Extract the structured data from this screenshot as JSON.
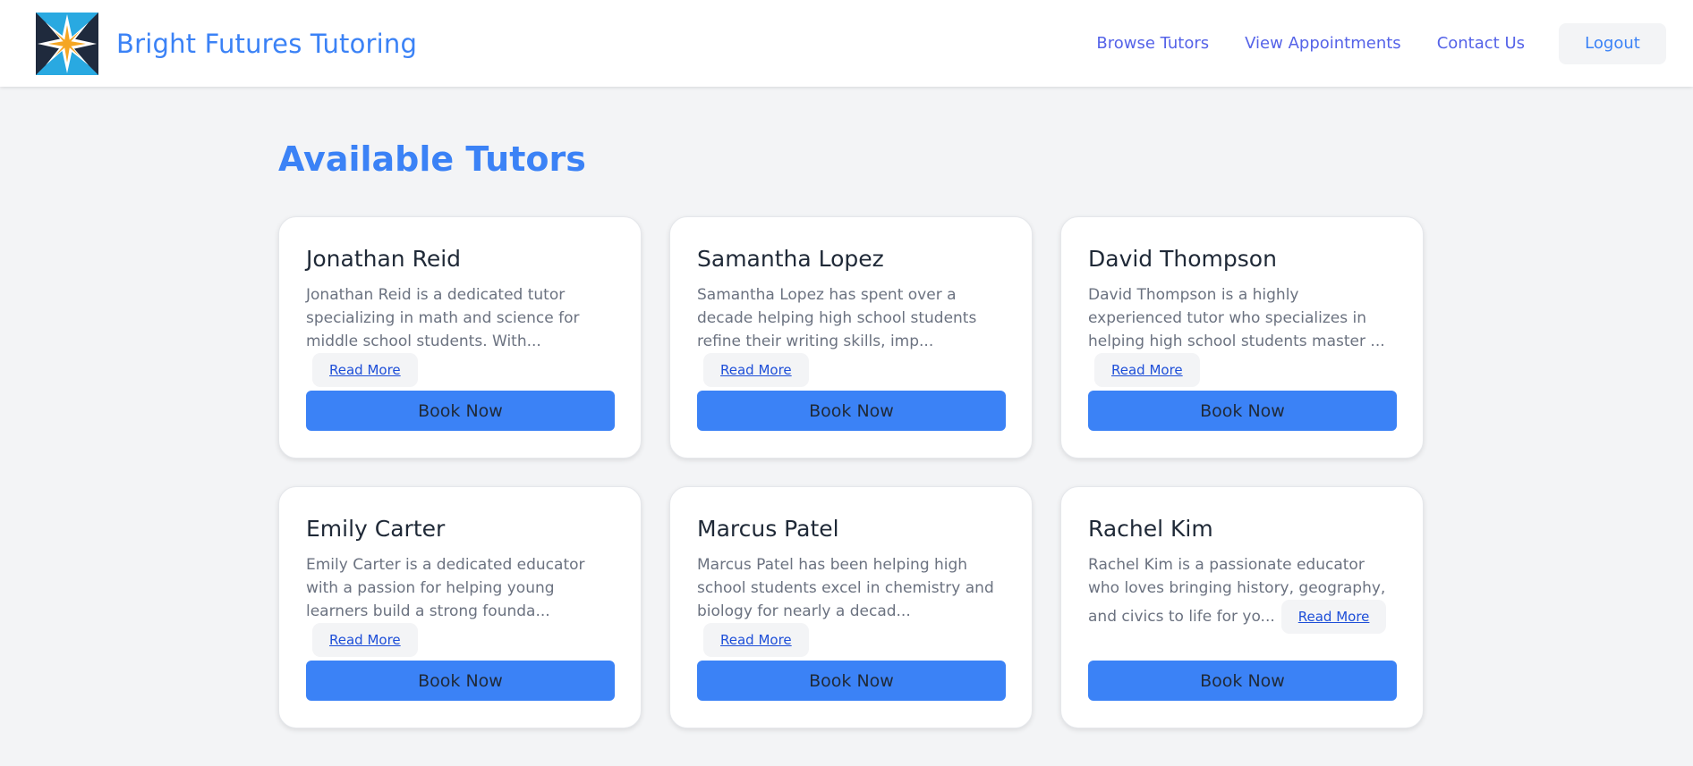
{
  "header": {
    "brand": "Bright Futures Tutoring",
    "logo_icon": "compass-star-icon",
    "nav": [
      {
        "label": "Browse Tutors"
      },
      {
        "label": "View Appointments"
      },
      {
        "label": "Contact Us"
      }
    ],
    "logout_label": "Logout"
  },
  "main": {
    "title": "Available Tutors",
    "read_more_label": "Read More",
    "book_label": "Book Now",
    "tutors": [
      {
        "name": "Jonathan Reid",
        "bio": "Jonathan Reid is a dedicated tutor specializing in math and science for middle school students. With..."
      },
      {
        "name": "Samantha Lopez",
        "bio": "Samantha Lopez has spent over a decade helping high school students refine their writing skills, imp..."
      },
      {
        "name": "David Thompson",
        "bio": "David Thompson is a highly experienced tutor who specializes in helping high school students master ..."
      },
      {
        "name": "Emily Carter",
        "bio": "Emily Carter is a dedicated educator with a passion for helping young learners build a strong founda..."
      },
      {
        "name": "Marcus Patel",
        "bio": "Marcus Patel has been helping high school students excel in chemistry and biology for nearly a decad..."
      },
      {
        "name": "Rachel Kim",
        "bio": "Rachel Kim is a passionate educator who loves bringing history, geography, and civics to life for yo..."
      }
    ]
  },
  "colors": {
    "accent": "#3b82f6",
    "nav_link": "#5563e8",
    "background": "#f3f4f6",
    "logo_dark": "#1f2a3d",
    "logo_cyan": "#29a9e1",
    "logo_orange": "#f5a623"
  }
}
